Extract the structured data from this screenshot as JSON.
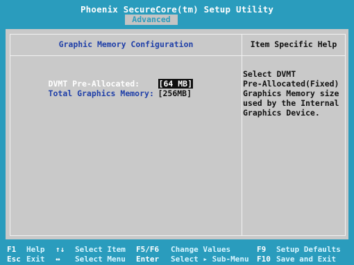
{
  "header": {
    "title": "Phoenix SecureCore(tm) Setup Utility",
    "active_tab": "Advanced"
  },
  "main": {
    "section_title": "Graphic Memory Configuration",
    "items": [
      {
        "label": "DVMT Pre-Allocated:",
        "value": "[64 MB]",
        "selected": true
      },
      {
        "label": "Total Graphics Memory:",
        "value": "[256MB]",
        "selected": false
      }
    ]
  },
  "help": {
    "title": "Item Specific Help",
    "lines": [
      "Select DVMT",
      "Pre-Allocated(Fixed)",
      "Graphics Memory size",
      "used by the Internal",
      "Graphics Device."
    ]
  },
  "footer": {
    "row1": [
      {
        "key": "F1",
        "desc": "Help"
      },
      {
        "key": "↑↓",
        "desc": "Select Item"
      },
      {
        "key": "F5/F6",
        "desc": "Change Values"
      },
      {
        "key": "F9",
        "desc": "Setup Defaults"
      }
    ],
    "row2": [
      {
        "key": "Esc",
        "desc": "Exit"
      },
      {
        "key": "↔",
        "desc": "Select Menu"
      },
      {
        "key": "Enter",
        "desc": "Select ▸ Sub-Menu"
      },
      {
        "key": "F10",
        "desc": "Save and Exit"
      }
    ]
  },
  "colors": {
    "background": "#2a9cbd",
    "panel": "#c9c9c9",
    "section_blue": "#1f3fa8",
    "highlight": "#101010"
  }
}
